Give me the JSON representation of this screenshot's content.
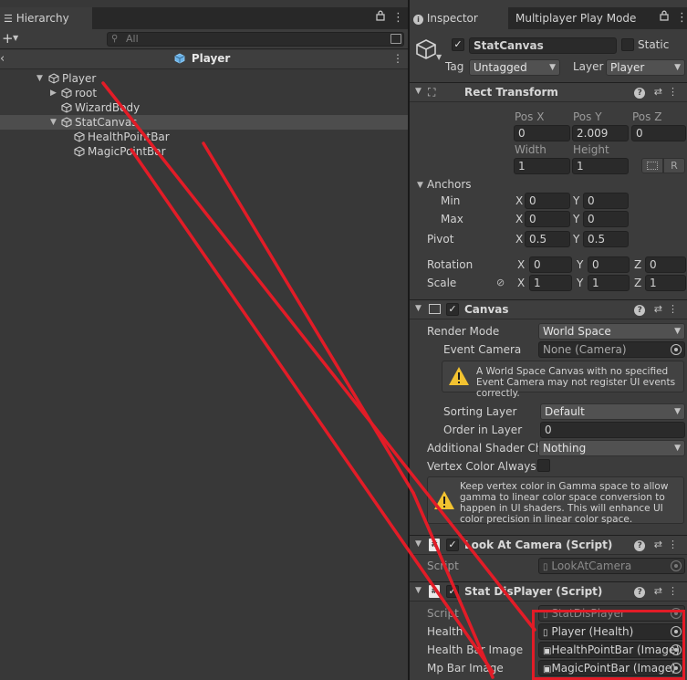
{
  "hierarchy": {
    "tab_label": "Hierarchy",
    "search_placeholder": "All",
    "scene_name": "Player",
    "items": [
      {
        "label": "Player"
      },
      {
        "label": "root"
      },
      {
        "label": "WizardBody"
      },
      {
        "label": "StatCanvas"
      },
      {
        "label": "HealthPointBar"
      },
      {
        "label": "MagicPointBar"
      }
    ]
  },
  "inspector": {
    "tab_label": "Inspector",
    "tab2_label": "Multiplayer Play Mode",
    "object_name": "StatCanvas",
    "static_label": "Static",
    "tag_label": "Tag",
    "tag_value": "Untagged",
    "layer_label": "Layer",
    "layer_value": "Player",
    "rect_transform": {
      "title": "Rect Transform",
      "posx_label": "Pos X",
      "posy_label": "Pos Y",
      "posz_label": "Pos Z",
      "posx": "0",
      "posy": "2.009",
      "posz": "0",
      "width_label": "Width",
      "height_label": "Height",
      "width": "1",
      "height": "1",
      "r_label": "R",
      "anchors_label": "Anchors",
      "min_label": "Min",
      "max_label": "Max",
      "x_label": "X",
      "y_label": "Y",
      "z_label": "Z",
      "min_x": "0",
      "min_y": "0",
      "max_x": "0",
      "max_y": "0",
      "pivot_label": "Pivot",
      "pivot_x": "0.5",
      "pivot_y": "0.5",
      "rotation_label": "Rotation",
      "rot_x": "0",
      "rot_y": "0",
      "rot_z": "0",
      "scale_label": "Scale",
      "scale_x": "1",
      "scale_y": "1",
      "scale_z": "1"
    },
    "canvas": {
      "title": "Canvas",
      "render_mode_label": "Render Mode",
      "render_mode": "World Space",
      "event_camera_label": "Event Camera",
      "event_camera": "None (Camera)",
      "warning1": "A World Space Canvas with no specified Event Camera may not register UI events correctly.",
      "sorting_layer_label": "Sorting Layer",
      "sorting_layer": "Default",
      "order_label": "Order in Layer",
      "order": "0",
      "shader_label": "Additional Shader Ch",
      "shader": "Nothing",
      "vertex_label": "Vertex Color Always",
      "warning2": "Keep vertex color in Gamma space to allow gamma to linear color space conversion to happen in UI shaders. This will enhance UI color precision in linear color space."
    },
    "look_at": {
      "title": "Look At Camera (Script)",
      "script_label": "Script",
      "script": "LookAtCamera"
    },
    "stat_display": {
      "title": "Stat DisPlayer (Script)",
      "script_label": "Script",
      "script": "StatDisPlayer",
      "health_label": "Health",
      "health": "Player (Health)",
      "health_bar_label": "Health Bar Image",
      "health_bar": "HealthPointBar (Image)",
      "mp_bar_label": "Mp Bar Image",
      "mp_bar": "MagicPointBar (Image)"
    }
  },
  "colors": {
    "annotation_red": "#e21c27",
    "panel_bg": "#383838",
    "inspector_bg": "#3c3c3c",
    "selection": "#4d4d4d"
  }
}
